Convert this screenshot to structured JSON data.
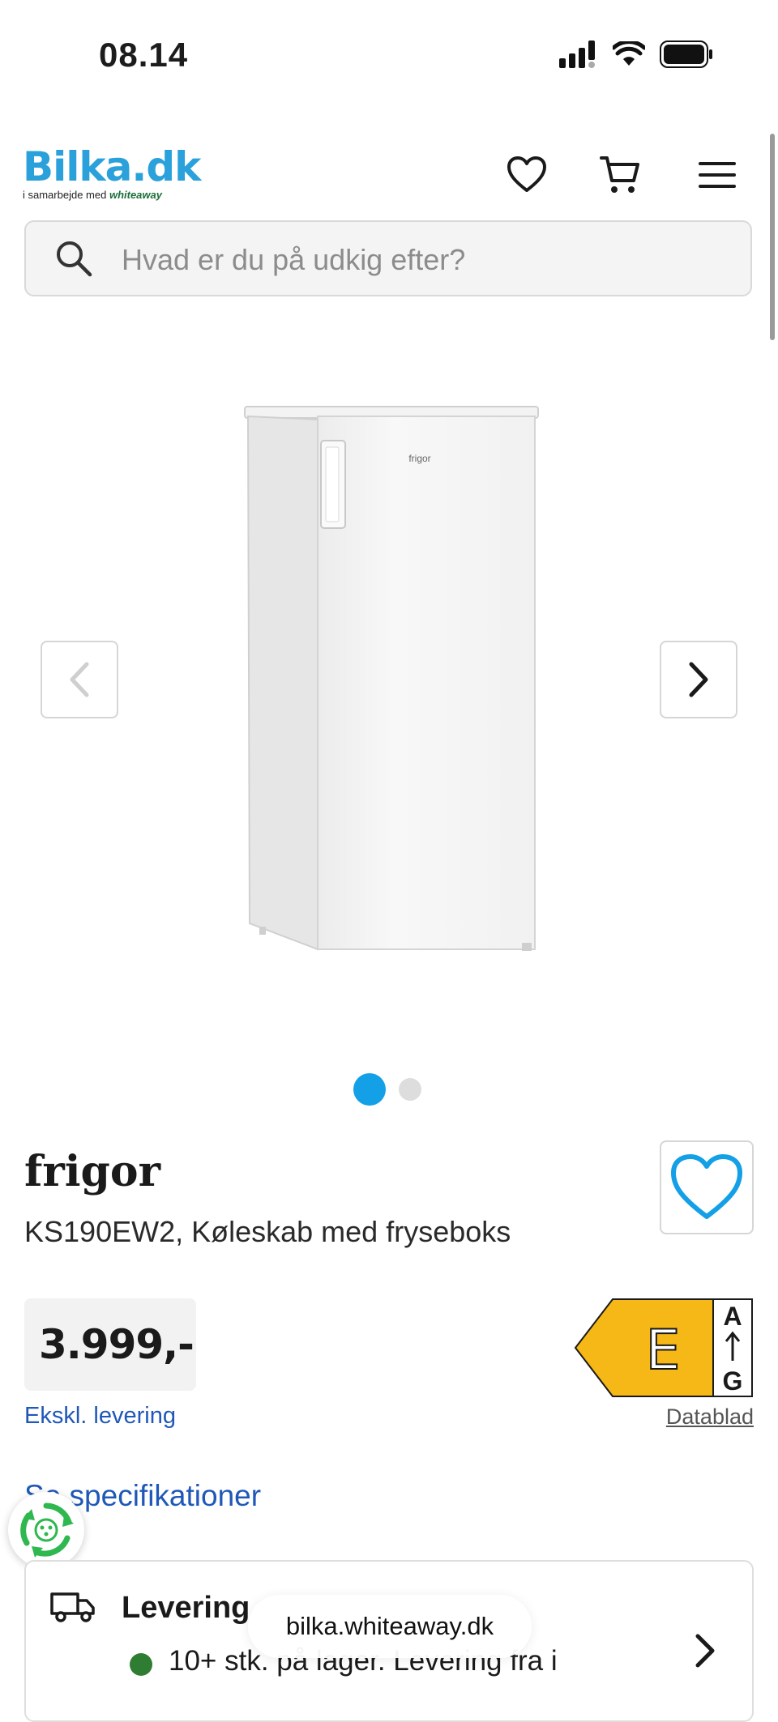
{
  "status_bar": {
    "time": "08.14"
  },
  "header": {
    "logo_text": "Bilka.dk",
    "logo_subtext": "i samarbejde med",
    "logo_partner": "whiteaway",
    "icons": [
      "heart-icon",
      "cart-icon",
      "menu-icon"
    ]
  },
  "search": {
    "placeholder": "Hvad er du på udkig efter?"
  },
  "gallery": {
    "image_brand_mark": "frigor",
    "slides": 2,
    "active_slide": 1
  },
  "product": {
    "brand": "frigor",
    "name": "KS190EW2, Køleskab med fryseboks",
    "price": "3.999,-",
    "delivery_note": "Ekskl. levering",
    "energy": {
      "class": "E",
      "top": "A",
      "bottom": "G",
      "color": "#f5b816"
    },
    "datasheet_link": "Datablad",
    "specs_link": "Se specifikationer"
  },
  "delivery_card": {
    "title": "Levering",
    "stock_text": "10+ stk. på lager. Levering fra i",
    "stock_color": "#2f7d32"
  },
  "browser": {
    "url": "bilka.whiteaway.dk"
  },
  "colors": {
    "accent": "#14a0e6",
    "link": "#1f58b8",
    "logo": "#2aa1db"
  }
}
